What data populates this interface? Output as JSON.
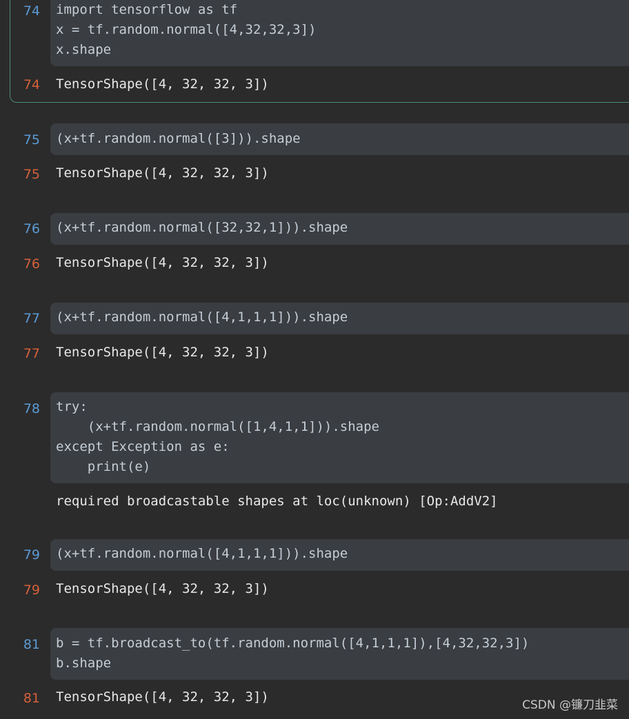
{
  "cells": [
    {
      "in_count": "74",
      "input": "import tensorflow as tf\nx = tf.random.normal([4,32,32,3])\nx.shape",
      "out_count": "74",
      "output": "TensorShape([4, 32, 32, 3])"
    },
    {
      "in_count": "75",
      "input": "(x+tf.random.normal([3])).shape",
      "out_count": "75",
      "output": "TensorShape([4, 32, 32, 3])"
    },
    {
      "in_count": "76",
      "input": "(x+tf.random.normal([32,32,1])).shape",
      "out_count": "76",
      "output": "TensorShape([4, 32, 32, 3])"
    },
    {
      "in_count": "77",
      "input": "(x+tf.random.normal([4,1,1,1])).shape",
      "out_count": "77",
      "output": "TensorShape([4, 32, 32, 3])"
    },
    {
      "in_count": "78",
      "input": "try:\n    (x+tf.random.normal([1,4,1,1])).shape\nexcept Exception as e:\n    print(e)",
      "out_count": "",
      "output": "required broadcastable shapes at loc(unknown) [Op:AddV2]"
    },
    {
      "in_count": "79",
      "input": "(x+tf.random.normal([4,1,1,1])).shape",
      "out_count": "79",
      "output": "TensorShape([4, 32, 32, 3])"
    },
    {
      "in_count": "81",
      "input": "b = tf.broadcast_to(tf.random.normal([4,1,1,1]),[4,32,32,3])\nb.shape",
      "out_count": "81",
      "output": "TensorShape([4, 32, 32, 3])"
    }
  ],
  "watermark": "CSDN @镰刀韭菜",
  "colors": {
    "background": "#2b2b2b",
    "input_box": "#3a3d41",
    "in_prompt": "#5b9bd5",
    "out_prompt": "#d6603b",
    "selected_border": "#4f8a6f"
  }
}
